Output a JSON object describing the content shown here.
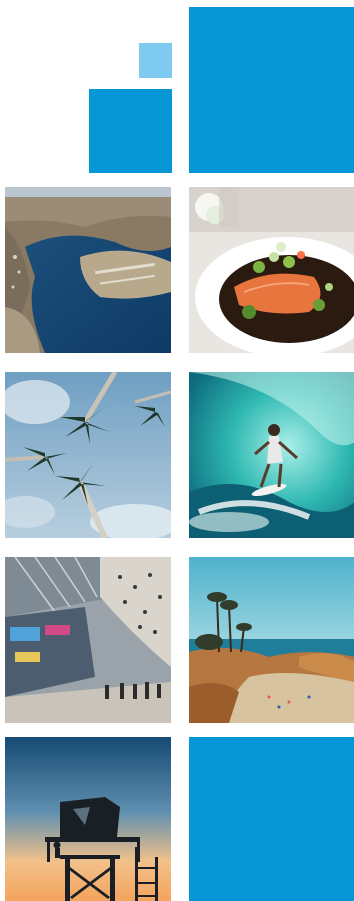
{
  "colors": {
    "accent": "#0797d6",
    "accent_light": "#7ecbef"
  },
  "tiles": [
    {
      "name": "blue-panel-top",
      "type": "color"
    },
    {
      "name": "photo-aerial-bay",
      "type": "photo"
    },
    {
      "name": "photo-salmon-dish",
      "type": "photo"
    },
    {
      "name": "photo-palm-trees",
      "type": "photo"
    },
    {
      "name": "photo-surfer-wave",
      "type": "photo"
    },
    {
      "name": "photo-mall-interior",
      "type": "photo"
    },
    {
      "name": "photo-coastal-beach",
      "type": "photo"
    },
    {
      "name": "photo-lifeguard-tower",
      "type": "photo"
    },
    {
      "name": "blue-panel-bottom",
      "type": "color"
    }
  ]
}
